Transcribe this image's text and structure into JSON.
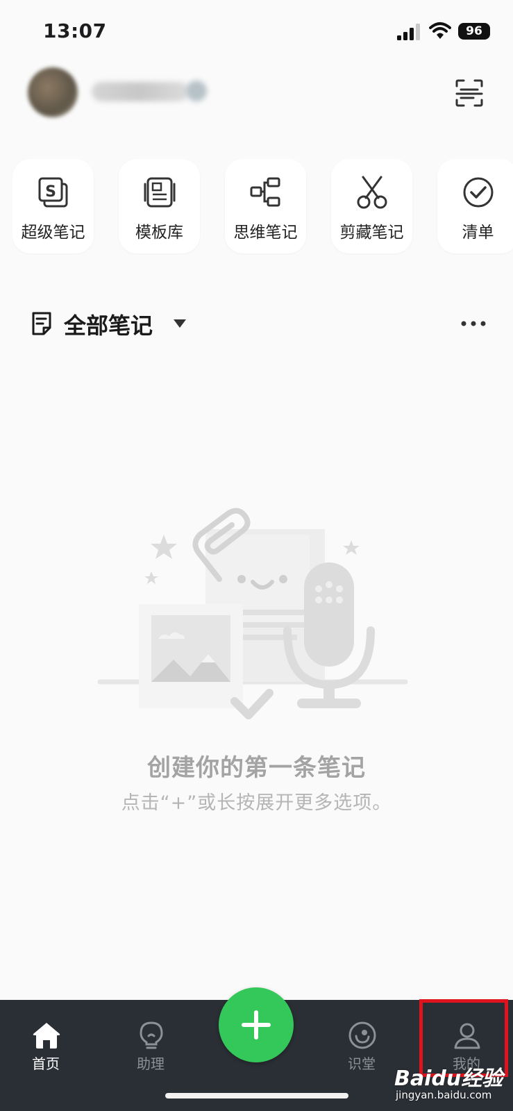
{
  "status_bar": {
    "time": "13:07",
    "battery": "96"
  },
  "header": {
    "scan_icon": "scan-icon"
  },
  "shortcuts": [
    {
      "label": "超级笔记",
      "icon": "super-note-icon"
    },
    {
      "label": "模板库",
      "icon": "template-icon"
    },
    {
      "label": "思维笔记",
      "icon": "mindmap-icon"
    },
    {
      "label": "剪藏笔记",
      "icon": "scissors-icon"
    },
    {
      "label": "清单",
      "icon": "checklist-icon"
    }
  ],
  "notes_section": {
    "title": "全部笔记"
  },
  "empty_state": {
    "title": "创建你的第一条笔记",
    "subtitle": "点击“+”或长按展开更多选项。"
  },
  "tabbar": {
    "tabs": [
      {
        "label": "首页",
        "icon": "home-icon",
        "active": true
      },
      {
        "label": "助理",
        "icon": "lightbulb-icon",
        "active": false
      },
      {
        "label": "识堂",
        "icon": "learning-icon",
        "active": false
      },
      {
        "label": "我的",
        "icon": "profile-icon",
        "active": false
      }
    ],
    "fab_icon": "plus-icon"
  },
  "watermark": {
    "main": "Baidu经验",
    "sub": "jingyan.baidu.com"
  },
  "colors": {
    "accent": "#34c759",
    "tabbar_bg": "#2a2e35",
    "highlight": "#e0141f"
  }
}
